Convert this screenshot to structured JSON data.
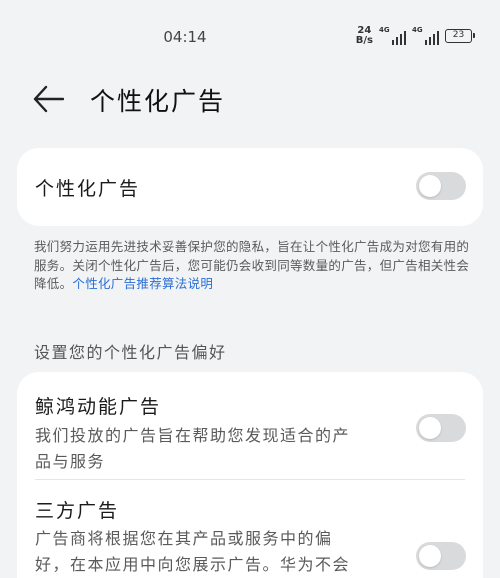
{
  "status": {
    "time": "04:14",
    "net_speed_value": "24",
    "net_speed_unit": "B/s",
    "signal1_tag": "4G",
    "signal2_tag": "4G",
    "battery": "23"
  },
  "header": {
    "title": "个性化广告"
  },
  "main_toggle": {
    "label": "个性化广告",
    "enabled": false
  },
  "description": {
    "text": "我们努力运用先进技术妥善保护您的隐私，旨在让个性化广告成为对您有用的服务。关闭个性化广告后，您可能仍会收到同等数量的广告，但广告相关性会降低。",
    "link": "个性化广告推荐算法说明"
  },
  "preferences": {
    "section_title": "设置您的个性化广告偏好",
    "items": [
      {
        "title": "鲸鸿动能广告",
        "subtitle_line1": "我们投放的广告旨在帮助您发现适合的产",
        "subtitle_line2": "品与服务",
        "enabled": false
      },
      {
        "title": "三方广告",
        "subtitle_line1": "广告商将根据您在其产品或服务中的偏",
        "subtitle_line2": "好，在本应用中向您展示广告。华为不会",
        "enabled": false
      }
    ]
  },
  "colors": {
    "background": "#f1f3f5",
    "card": "#ffffff",
    "toggle_off": "#d9dadc",
    "link": "#2a6fd6"
  }
}
